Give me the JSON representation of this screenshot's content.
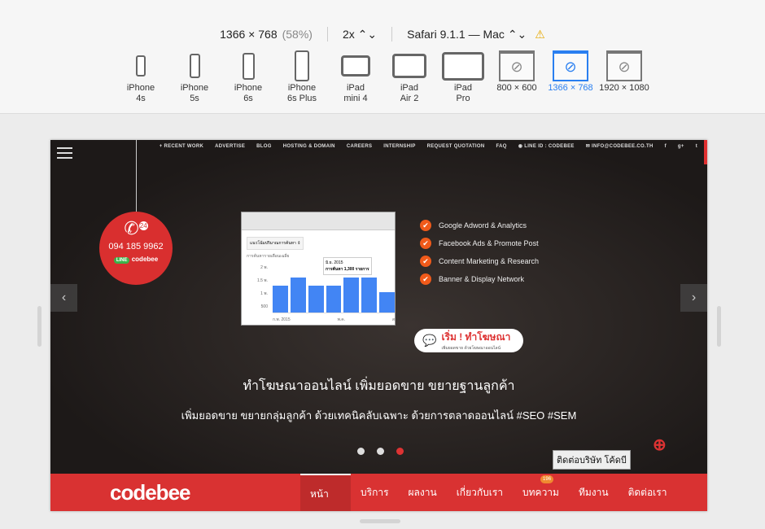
{
  "toolbar": {
    "resolution": "1366 × 768",
    "scale_percent": "(58%)",
    "pixel_ratio": "2x ⌃⌄",
    "browser": "Safari 9.1.1 — Mac ⌃⌄",
    "warning_icon": "warning-icon",
    "devices": [
      {
        "l1": "iPhone",
        "l2": "4s",
        "type": "phone",
        "w": 12,
        "h": 26
      },
      {
        "l1": "iPhone",
        "l2": "5s",
        "type": "phone",
        "w": 13,
        "h": 30
      },
      {
        "l1": "iPhone",
        "l2": "6s",
        "type": "phone",
        "w": 15,
        "h": 33
      },
      {
        "l1": "iPhone",
        "l2": "6s Plus",
        "type": "phone",
        "w": 18,
        "h": 38
      },
      {
        "l1": "iPad",
        "l2": "mini 4",
        "type": "tab",
        "w": 36,
        "h": 26
      },
      {
        "l1": "iPad",
        "l2": "Air 2",
        "type": "tab",
        "w": 42,
        "h": 30
      },
      {
        "l1": "iPad",
        "l2": "Pro",
        "type": "tab",
        "w": 52,
        "h": 35
      },
      {
        "l1": "800 × 600",
        "l2": "",
        "type": "win"
      },
      {
        "l1": "1366 × 768",
        "l2": "",
        "type": "win",
        "selected": true
      },
      {
        "l1": "1920 × 1080",
        "l2": "",
        "type": "win"
      }
    ]
  },
  "site": {
    "topnav": [
      "+ RECENT WORK",
      "ADVERTISE",
      "BLOG",
      "HOSTING & DOMAIN",
      "CAREERS",
      "INTERNSHIP",
      "REQUEST QUOTATION",
      "FAQ",
      "◉ LINE ID : CODEBEE",
      "✉ INFO@CODEBEE.CO.TH",
      "f",
      "g+",
      "t"
    ],
    "tag": {
      "badge": "24",
      "phone": "094 185 9962",
      "line_label": "LINE",
      "line_name": "codebee"
    },
    "mini": {
      "select": "แนวโน้มปริมาณการค้นหา ⇕",
      "title": "การค้นหารายเดือนเฉลี่ย",
      "yticks": [
        "2 พ.",
        "1.5 พ.",
        "1 พ.",
        "500"
      ],
      "tooltip_date": "มิ.ย. 2015",
      "tooltip_value": "การค้นหา 1,300 รายการ",
      "xticks": [
        "ก.พ. 2015",
        "พ.ค.",
        "ส"
      ],
      "bars": [
        1050,
        1400,
        1050,
        1050,
        1400,
        1400,
        800
      ],
      "ymax": 2000
    },
    "checks": [
      "Google Adword & Analytics",
      "Facebook Ads & Promote Post",
      "Content Marketing & Research",
      "Banner & Display Network"
    ],
    "cta": {
      "title": "เริ่ม ! ทำโฆษณา",
      "sub": "เพิ่มยอดขาย ด้วยโฆษณาออนไลน์"
    },
    "headline": "ทำโฆษณาออนไลน์ เพิ่มยอดขาย ขยายฐานลูกค้า",
    "subheadline": "เพิ่มยอดขาย ขยายกลุ่มลูกค้า ด้วยเทคนิคลับเฉพาะ ด้วยการตลาดออนไลน์ #SEO #SEM",
    "slides": {
      "count": 3,
      "active": 3
    },
    "tooltip": "ติดต่อบริษัท โค้ดบี",
    "logo": "codebee",
    "menu": [
      {
        "label": "หน้าแรก",
        "active": true
      },
      {
        "label": "บริการ"
      },
      {
        "label": "ผลงาน"
      },
      {
        "label": "เกี่ยวกับเรา"
      },
      {
        "label": "บทความ",
        "badge": "196"
      },
      {
        "label": "ทีมงาน"
      },
      {
        "label": "ติดต่อเรา"
      }
    ],
    "colors": {
      "brand_red": "#d93232",
      "check_orange": "#f05a1a",
      "bar_blue": "#4285f4",
      "selected_blue": "#2a7ff0"
    }
  }
}
